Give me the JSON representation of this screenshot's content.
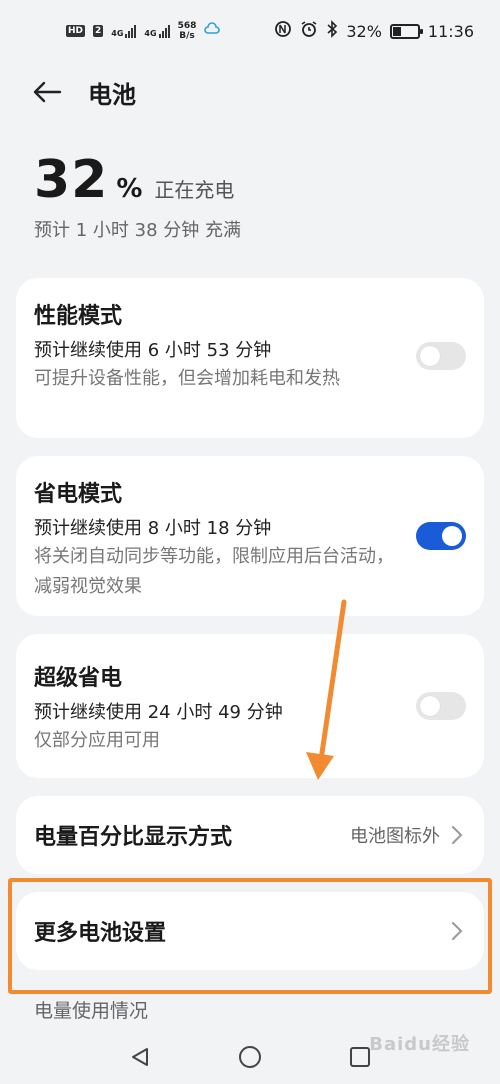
{
  "status_bar": {
    "hd": "HD",
    "sim2": "2",
    "net1": "4G",
    "net2": "4G",
    "speed_value": "568",
    "speed_unit": "B/s",
    "battery_percent": "32%",
    "battery_level": 0.32,
    "time": "11:36"
  },
  "header": {
    "title": "电池"
  },
  "battery": {
    "level": "32",
    "unit": "%",
    "status": "正在充电",
    "eta": "预计 1 小时 38 分钟 充满"
  },
  "modes": [
    {
      "title": "性能模式",
      "estimate": "预计继续使用 6 小时 53 分钟",
      "description": "可提升设备性能，但会增加耗电和发热",
      "enabled": false
    },
    {
      "title": "省电模式",
      "estimate": "预计继续使用 8 小时 18 分钟",
      "description": "将关闭自动同步等功能，限制应用后台活动，减弱视觉效果",
      "enabled": true
    },
    {
      "title": "超级省电",
      "estimate": "预计继续使用 24 小时 49 分钟",
      "description": "仅部分应用可用",
      "enabled": false
    }
  ],
  "percentage_display": {
    "label": "电量百分比显示方式",
    "value": "电池图标外"
  },
  "more_settings": {
    "label": "更多电池设置"
  },
  "usage_section": {
    "label": "电量使用情况"
  },
  "colors": {
    "accent": "#1a5cd7",
    "annotation": "#f28a32",
    "background": "#f1f3f5"
  },
  "icons": {
    "back": "back-arrow-icon",
    "chevron": "chevron-right-icon",
    "nav_back": "triangle-back-icon",
    "nav_home": "circle-home-icon",
    "nav_recent": "square-recent-icon"
  },
  "watermark": "Baidu经验"
}
